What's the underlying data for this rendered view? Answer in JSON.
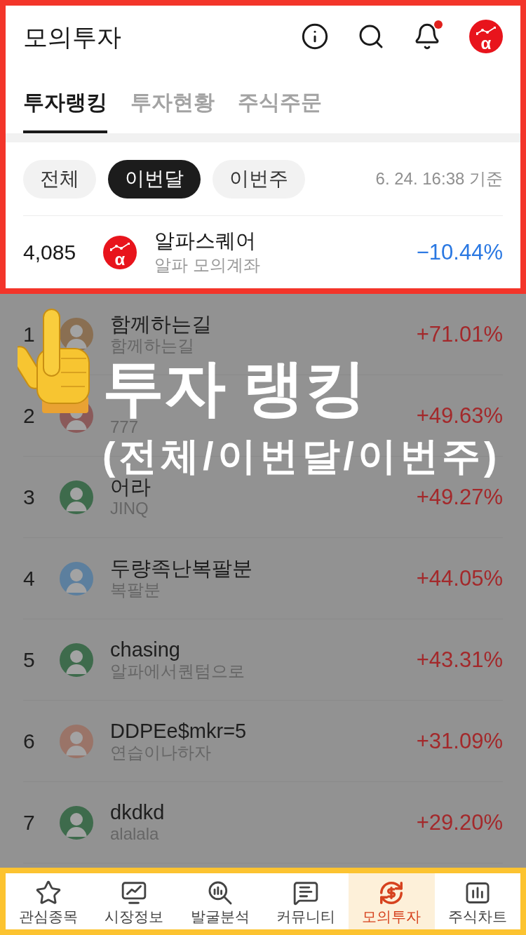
{
  "header": {
    "title": "모의투자",
    "unread": true,
    "logo_symbol": "α"
  },
  "tabs": [
    {
      "label": "투자랭킹",
      "selected": true
    },
    {
      "label": "투자현황",
      "selected": false
    },
    {
      "label": "주식주문",
      "selected": false
    }
  ],
  "filters": [
    {
      "label": "전체",
      "selected": false
    },
    {
      "label": "이번달",
      "selected": true
    },
    {
      "label": "이번주",
      "selected": false
    }
  ],
  "timestamp": "6. 24. 16:38 기준",
  "my_ranking": {
    "rank": "4,085",
    "logo_symbol": "α",
    "name": "알파스퀘어",
    "account": "알파 모의계좌",
    "return": "−10.44%",
    "kind": "loss"
  },
  "rankings": [
    {
      "rank": "1",
      "color": "#8a6f52",
      "name": "함께하는길",
      "subtitle": "함께하는길",
      "return": "+71.01%",
      "kind": "gain"
    },
    {
      "rank": "2",
      "color": "#8a5a5a",
      "subtitle": "777",
      "return": "+49.63%",
      "kind": "gain"
    },
    {
      "rank": "3",
      "color": "#3e6b4c",
      "name": "어라",
      "subtitle": "JINQ",
      "return": "+49.27%",
      "kind": "gain"
    },
    {
      "rank": "4",
      "color": "#5c7f9e",
      "name": "두량족난복팔분",
      "subtitle": "복팔분",
      "return": "+44.05%",
      "kind": "gain"
    },
    {
      "rank": "5",
      "color": "#3e6b4c",
      "name": "chasing",
      "subtitle": "알파에서퀀텀으로",
      "return": "+43.31%",
      "kind": "gain"
    },
    {
      "rank": "6",
      "color": "#9a7468",
      "name": "DDPEe$mkr=5",
      "subtitle": "연습이나하자",
      "return": "+31.09%",
      "kind": "gain"
    },
    {
      "rank": "7",
      "color": "#3e6b4c",
      "name": "dkdkd",
      "subtitle": "alalala",
      "return": "+29.20%",
      "kind": "gain"
    }
  ],
  "annotation": {
    "title": "투자 랭킹",
    "subtitle": "(전체/이번달/이번주)"
  },
  "bottom_nav": [
    {
      "label": "관심종목",
      "selected": false
    },
    {
      "label": "시장정보",
      "selected": false
    },
    {
      "label": "발굴분석",
      "selected": false
    },
    {
      "label": "커뮤니티",
      "selected": false
    },
    {
      "label": "모의투자",
      "selected": true
    },
    {
      "label": "주식차트",
      "selected": false
    }
  ]
}
